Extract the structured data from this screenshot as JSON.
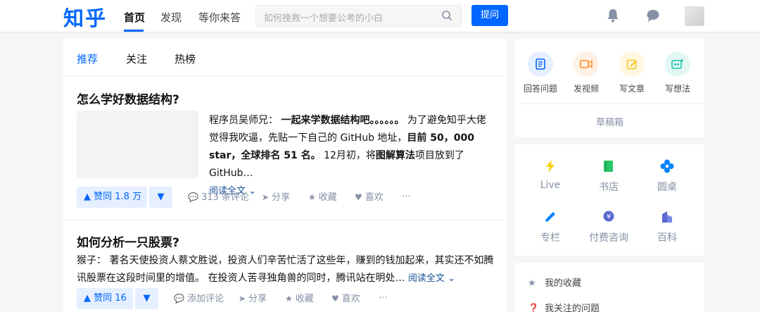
{
  "header": {
    "logo": "知乎",
    "nav": [
      "首页",
      "发现",
      "等你来答"
    ],
    "search_placeholder": "如何挽救一个想要公考的小白",
    "ask_label": "提问"
  },
  "feed": {
    "tabs": [
      "推荐",
      "关注",
      "热榜"
    ],
    "items": [
      {
        "title": "怎么学好数据结构?",
        "excerpt": {
          "author": "程序员吴师兄：",
          "b1": "一起来学数据结构吧。。。。。。",
          "t1": "为了避免知乎大佬觉得我吹逼，先贴一下自己的 GitHub 地址，",
          "b2": "目前 50，000 star，全球排名 51 名。",
          "t2": "12月初，将",
          "b3": "图解算法",
          "t3": "项目放到了GitHub…"
        },
        "read_more": "阅读全文",
        "vote_label": "赞同 1.8 万",
        "actions": [
          "313 条评论",
          "分享",
          "收藏",
          "喜欢",
          "···"
        ]
      },
      {
        "title": "如何分析一只股票?",
        "excerpt": "猴子： 著名天使投资人蔡文胜说，投资人们辛苦忙活了这些年，赚到的钱加起来，其实还不如腾讯股票在这段时间里的增值。 在投资人苦寻独角兽的同时，腾讯站在明处…",
        "read_more": "阅读全文",
        "vote_label": "赞同 16",
        "actions": [
          "添加评论",
          "分享",
          "收藏",
          "喜欢",
          "···"
        ]
      }
    ]
  },
  "sidebar": {
    "quick_actions": [
      "回答问题",
      "发视频",
      "写文章",
      "写想法"
    ],
    "drafts": "草稿箱",
    "categories": [
      "Live",
      "书店",
      "圆桌",
      "专栏",
      "付费咨询",
      "百科"
    ],
    "links": [
      "我的收藏",
      "我关注的问题"
    ]
  },
  "colors": {
    "brand": "#0066ff",
    "muted": "#8590a6",
    "link": "#175199"
  }
}
